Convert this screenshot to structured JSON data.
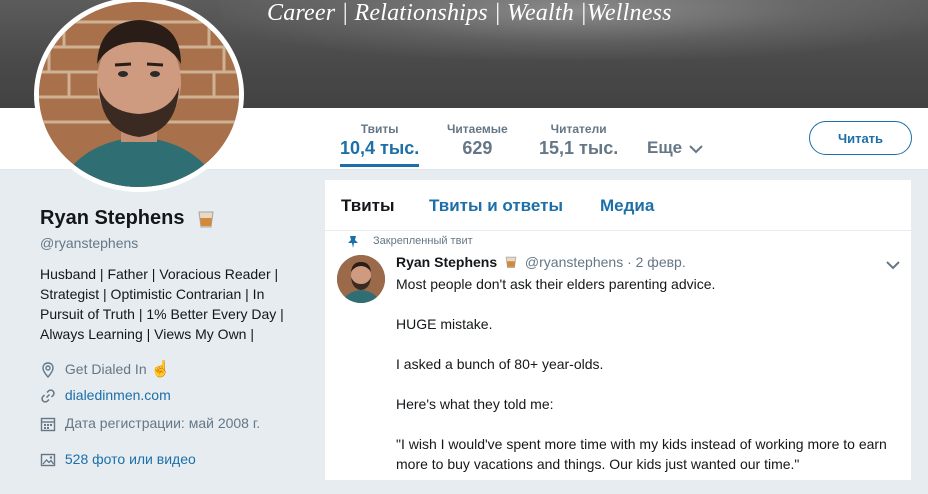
{
  "banner": {
    "text": "Career | Relationships | Wealth |Wellness"
  },
  "nav": {
    "stats": [
      {
        "label": "Твиты",
        "value": "10,4 тыс."
      },
      {
        "label": "Читаемые",
        "value": "629"
      },
      {
        "label": "Читатели",
        "value": "15,1 тыс."
      }
    ],
    "more_label": "Еще",
    "follow_label": "Читать"
  },
  "profile": {
    "name": "Ryan Stephens",
    "handle": "@ryanstephens",
    "bio": "Husband | Father | Voracious Reader | Strategist | Optimistic Contrarian | In Pursuit of Truth | 1% Better Every Day | Always Learning | Views My Own |",
    "location": "Get Dialed In",
    "website": "dialedinmen.com",
    "joined": "Дата регистрации: май 2008 г.",
    "photos": "528 фото или видео"
  },
  "timeline": {
    "tabs": [
      "Твиты",
      "Твиты и ответы",
      "Медиа"
    ],
    "pinned_label": "Закрепленный твит",
    "tweet": {
      "name": "Ryan Stephens",
      "handle_date": "@ryanstephens · 2 февр.",
      "lines": [
        "Most people don't ask their elders parenting advice.",
        "HUGE mistake.",
        "I asked a bunch of 80+ year-olds.",
        "Here's what they told me:",
        "\"I wish I would've spent more time with my kids instead of working more to earn more to buy vacations and things. Our kids just wanted our time.\""
      ]
    }
  },
  "colors": {
    "accent": "#1c6fa8",
    "muted": "#657786",
    "bg": "#e6ecf0"
  }
}
